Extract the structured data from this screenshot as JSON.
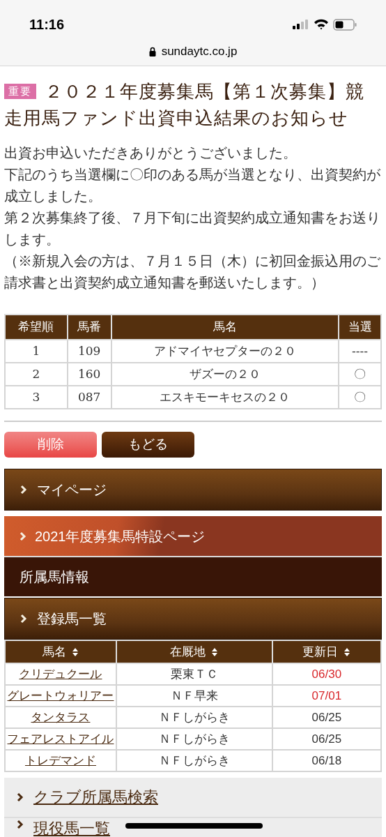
{
  "status_bar": {
    "time": "11:16"
  },
  "address_bar": {
    "url": "sundaytc.co.jp"
  },
  "notice": {
    "badge": "重要",
    "title_lines": [
      "２０２１年度募集馬【第１次募集】競",
      "走用馬ファンド出資申込結果のお知らせ"
    ],
    "paragraphs": [
      "出資お申込いただきありがとうございました。",
      "下記のうち当選欄に〇印のある馬が当選となり、出資契約が成立しました。",
      "第２次募集終了後、７月下旬に出資契約成立通知書をお送りします。",
      "（※新規入会の方は、７月１５日（木）に初回金振込用のご請求書と出資契約成立通知書を郵送いたします。）"
    ]
  },
  "results_table": {
    "columns": [
      "希望順",
      "馬番",
      "馬名",
      "当選"
    ],
    "rows": [
      {
        "cells": [
          "1",
          "109",
          "アドマイヤセプターの２０",
          "----"
        ]
      },
      {
        "cells": [
          "2",
          "160",
          "ザズーの２０",
          "〇"
        ]
      },
      {
        "cells": [
          "3",
          "087",
          "エスキモーキセスの２０",
          "〇"
        ]
      }
    ]
  },
  "buttons": [
    {
      "label": "削除",
      "kind": "danger"
    },
    {
      "label": "もどる",
      "kind": "primary"
    }
  ],
  "menu": [
    {
      "label": "マイページ",
      "kind": "pattern"
    },
    {
      "label": "2021年度募集馬特設ページ",
      "kind": "special"
    },
    {
      "label": "所属馬情報",
      "kind": "heading"
    },
    {
      "label": "登録馬一覧",
      "kind": "pattern"
    }
  ],
  "horse_table": {
    "columns": [
      "馬名",
      "在厩地",
      "更新日"
    ],
    "rows": [
      {
        "name": "クリデュクール",
        "location": "栗東ＴＣ",
        "updated": "06/30",
        "highlight": true
      },
      {
        "name": "グレートウォリアー",
        "location": "ＮＦ早来",
        "updated": "07/01",
        "highlight": true
      },
      {
        "name": "タンタラス",
        "location": "ＮＦしがらき",
        "updated": "06/25",
        "highlight": false
      },
      {
        "name": "フェアレストアイル",
        "location": "ＮＦしがらき",
        "updated": "06/25",
        "highlight": false
      },
      {
        "name": "トレデマンド",
        "location": "ＮＦしがらき",
        "updated": "06/18",
        "highlight": false
      }
    ]
  },
  "links": [
    {
      "label": "クラブ所属馬検索"
    },
    {
      "label": "現役馬一覧"
    }
  ]
}
